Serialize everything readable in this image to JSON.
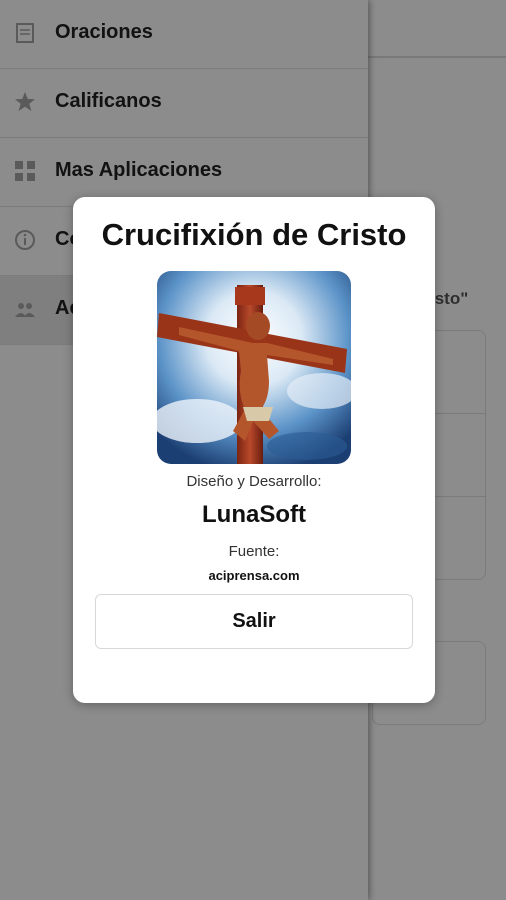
{
  "drawer": {
    "items": [
      {
        "label": "Oraciones",
        "icon": "book-icon",
        "active": false
      },
      {
        "label": "Calificanos",
        "icon": "star-icon",
        "active": false
      },
      {
        "label": "Mas Aplicaciones",
        "icon": "grid-icon",
        "active": false
      },
      {
        "label": "Co",
        "icon": "info-icon",
        "active": false
      },
      {
        "label": "Ac",
        "icon": "people-icon",
        "active": true
      }
    ]
  },
  "background": {
    "subtitle_fragment": "isto\""
  },
  "dialog": {
    "title": "Crucifixión de Cristo",
    "image_icon": "crucifix-image",
    "design_label": "Diseño y Desarrollo:",
    "company": "LunaSoft",
    "source_label": "Fuente:",
    "source": "aciprensa.com",
    "exit_label": "Salir"
  }
}
